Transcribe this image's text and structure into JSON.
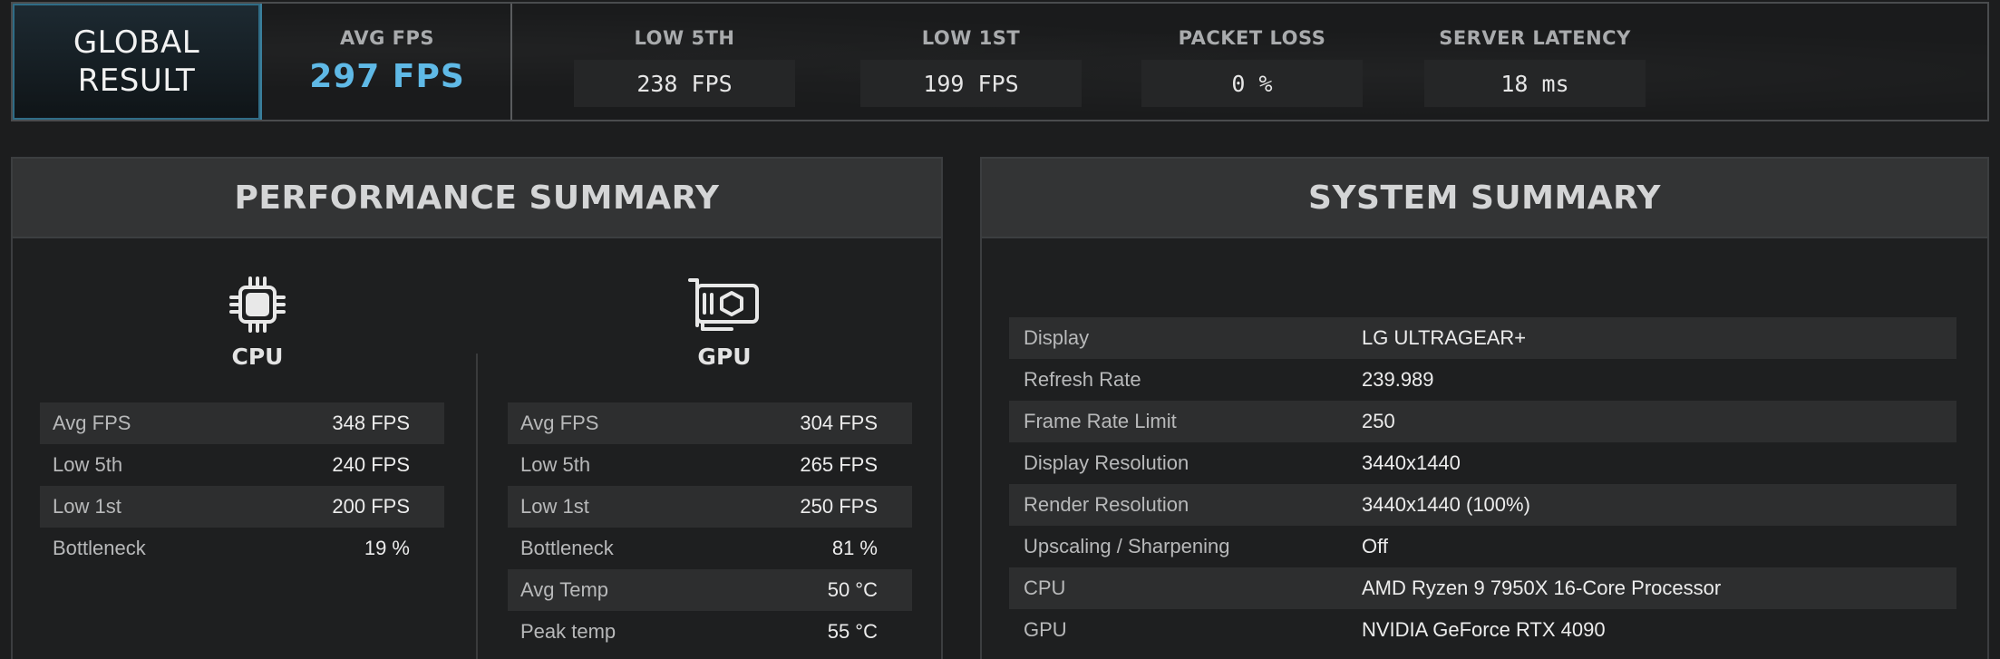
{
  "topbar": {
    "global_line1": "GLOBAL",
    "global_line2": "RESULT",
    "avg_fps_label": "AVG FPS",
    "avg_fps_value": "297 FPS",
    "metrics": [
      {
        "label": "LOW 5TH",
        "value": "238 FPS"
      },
      {
        "label": "LOW 1ST",
        "value": "199 FPS"
      },
      {
        "label": "PACKET LOSS",
        "value": "0 %"
      },
      {
        "label": "SERVER LATENCY",
        "value": "18 ms"
      }
    ]
  },
  "performance": {
    "title": "PERFORMANCE SUMMARY",
    "cpu": {
      "icon": "cpu-chip-icon",
      "title": "CPU",
      "rows": [
        {
          "k": "Avg FPS",
          "v": "348 FPS"
        },
        {
          "k": "Low 5th",
          "v": "240 FPS"
        },
        {
          "k": "Low 1st",
          "v": "200 FPS"
        },
        {
          "k": "Bottleneck",
          "v": "19 %"
        }
      ]
    },
    "gpu": {
      "icon": "graphics-card-icon",
      "title": "GPU",
      "rows": [
        {
          "k": "Avg FPS",
          "v": "304 FPS"
        },
        {
          "k": "Low 5th",
          "v": "265 FPS"
        },
        {
          "k": "Low 1st",
          "v": "250 FPS"
        },
        {
          "k": "Bottleneck",
          "v": "81 %"
        },
        {
          "k": "Avg Temp",
          "v": "50 °C"
        },
        {
          "k": "Peak temp",
          "v": "55 °C"
        }
      ]
    }
  },
  "system": {
    "title": "SYSTEM SUMMARY",
    "rows": [
      {
        "k": "Display",
        "v": "LG ULTRAGEAR+"
      },
      {
        "k": "Refresh Rate",
        "v": "239.989"
      },
      {
        "k": "Frame Rate Limit",
        "v": "250"
      },
      {
        "k": "Display Resolution",
        "v": "3440x1440"
      },
      {
        "k": "Render Resolution",
        "v": "3440x1440 (100%)"
      },
      {
        "k": "Upscaling / Sharpening",
        "v": "Off"
      },
      {
        "k": "CPU",
        "v": "AMD Ryzen 9 7950X 16-Core Processor"
      },
      {
        "k": "GPU",
        "v": "NVIDIA GeForce RTX 4090"
      }
    ]
  },
  "colors": {
    "accent_blue": "#5fb9e6",
    "background": "#1c1d1e",
    "row_stripe": "#2d2e2f"
  }
}
